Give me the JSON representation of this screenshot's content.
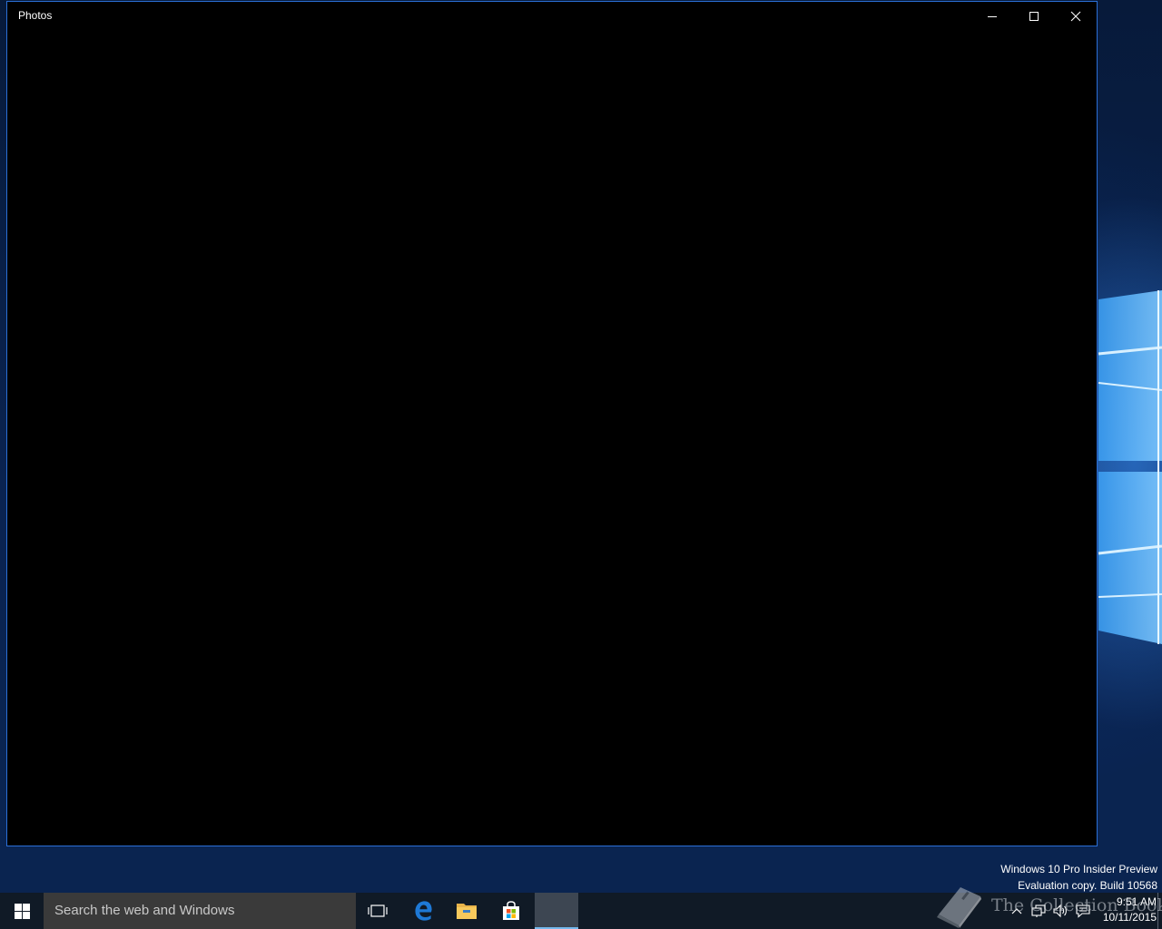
{
  "window": {
    "title": "Photos"
  },
  "watermark": {
    "line1": "Windows 10 Pro Insider Preview",
    "line2": "Evaluation copy. Build 10568"
  },
  "overlay_logo": {
    "text": "The Collection Book",
    "icon": "book-icon"
  },
  "taskbar": {
    "search_placeholder": "Search the web and Windows",
    "pinned": [
      {
        "name": "task-view",
        "icon": "task-view-icon"
      },
      {
        "name": "edge",
        "icon": "edge-icon"
      },
      {
        "name": "file-explorer",
        "icon": "folder-icon"
      },
      {
        "name": "store",
        "icon": "store-icon"
      },
      {
        "name": "photos",
        "icon": "photos-icon",
        "active": true
      }
    ],
    "clock": {
      "time": "9:51 AM",
      "date": "10/11/2015"
    }
  },
  "colors": {
    "window_border": "#2b6fd6",
    "taskbar": "#101a26",
    "search_box": "#3a3a3a",
    "active_indicator": "#76b9ed",
    "desktop_accent": "#3c96ff"
  }
}
